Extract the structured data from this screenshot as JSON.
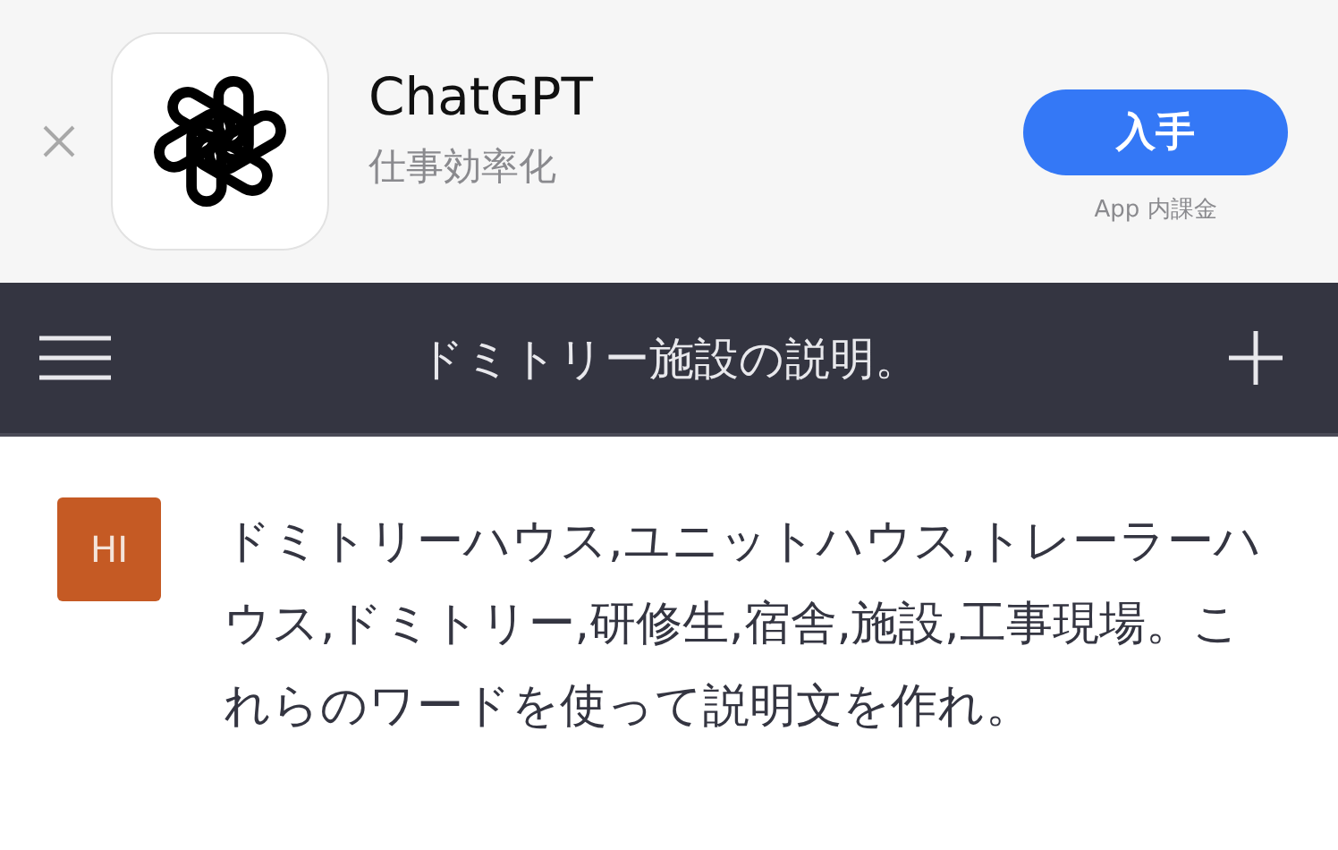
{
  "app_banner": {
    "app_name": "ChatGPT",
    "category": "仕事効率化",
    "get_button": "入手",
    "purchase_note": "App 内課金"
  },
  "nav_bar": {
    "title": "ドミトリー施設の説明。"
  },
  "messages": [
    {
      "avatar": "HI",
      "text": "ドミトリーハウス,ユニットハウス,トレーラーハウス,ドミトリー,研修生,宿舎,施設,工事現場。これらのワードを使って説明文を作れ。"
    }
  ]
}
